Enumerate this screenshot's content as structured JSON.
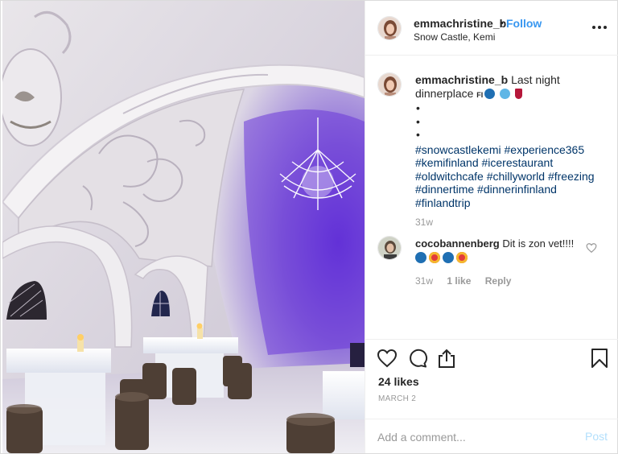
{
  "header": {
    "username": "emmachristine_b",
    "separator": "•",
    "follow_label": "Follow",
    "location": "Snow Castle, Kemi",
    "more_icon": "more-horizontal-icon"
  },
  "caption": {
    "username": "emmachristine_b",
    "text": "Last night dinnerplace",
    "flag_text": "FI",
    "emojis": [
      "snowflake",
      "cold-face",
      "wine-glass"
    ],
    "bullets": [
      "•",
      "•",
      "•"
    ],
    "hashtags": [
      "#snowcastlekemi",
      "#experience365",
      "#kemifinland",
      "#icerestaurant",
      "#oldwitchcafe",
      "#chillyworld",
      "#freezing",
      "#dinnertime",
      "#dinnerinfinland",
      "#finlandtrip"
    ],
    "time_ago": "31w"
  },
  "comments": [
    {
      "username": "cocobannenberg",
      "text": "Dit is zon vet!!!!",
      "emojis": [
        "snowflake",
        "heart-eyes",
        "snowflake",
        "heart-eyes"
      ],
      "time_ago": "31w",
      "likes_label": "1 like",
      "reply_label": "Reply"
    }
  ],
  "actions": {
    "like_icon": "heart-icon",
    "comment_icon": "comment-icon",
    "share_icon": "share-icon",
    "save_icon": "bookmark-icon",
    "likes_text": "24 likes",
    "date": "MARCH 2"
  },
  "add_comment": {
    "placeholder": "Add a comment...",
    "post_label": "Post"
  },
  "colors": {
    "link_blue": "#3897f0",
    "hashtag": "#003569",
    "muted": "#999999",
    "post_disabled": "#b2dffc",
    "text": "#262626"
  }
}
